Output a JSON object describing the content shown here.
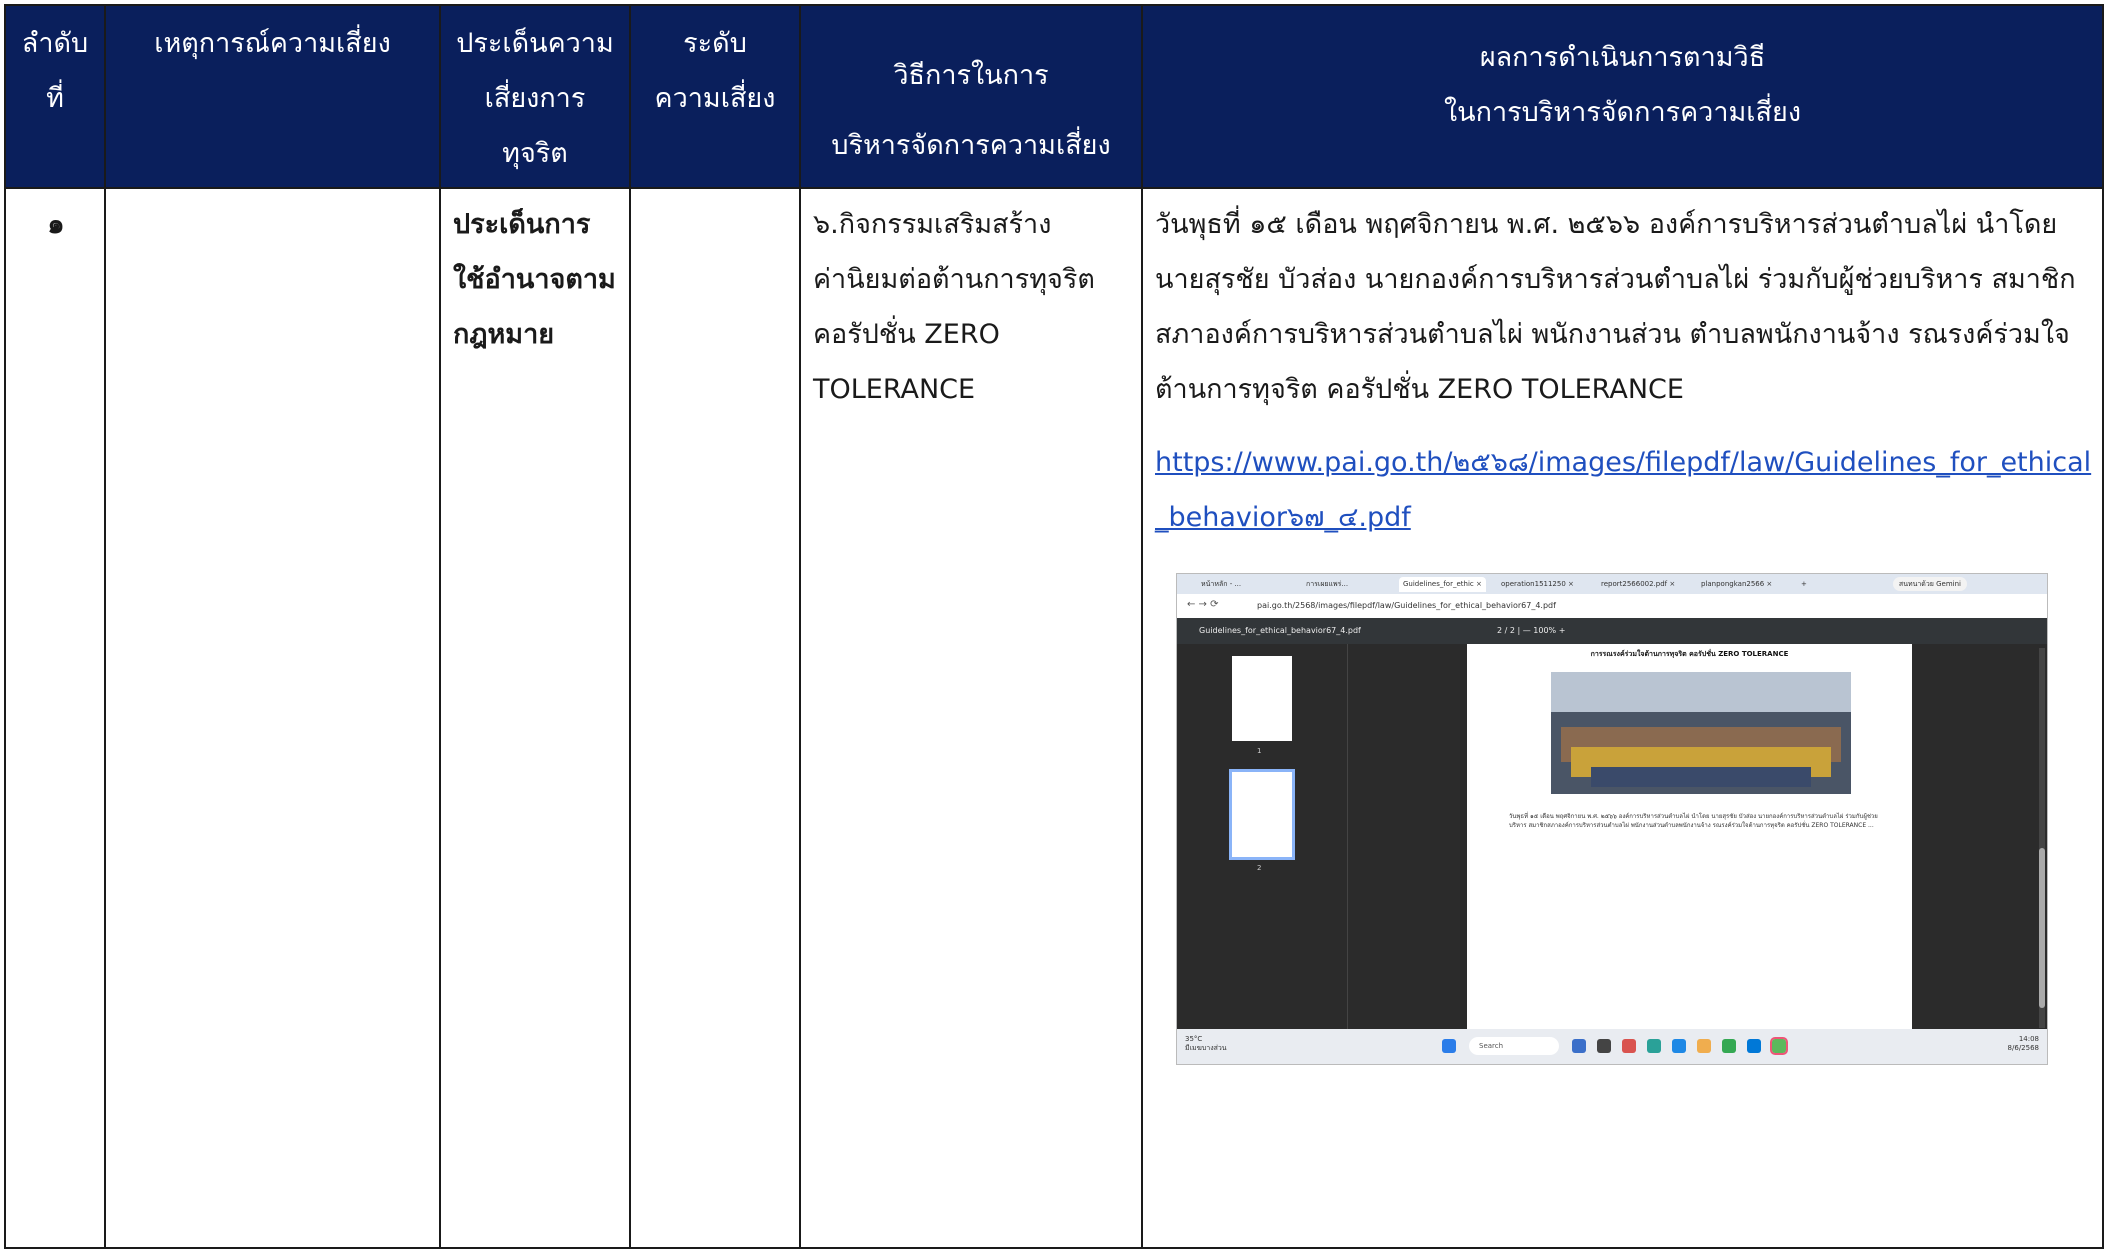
{
  "header": {
    "col_no": "ลำดับ\nที่",
    "col_event": "เหตุการณ์ความเสี่ยง",
    "col_issue": "ประเด็นความ\nเสี่ยงการ\nทุจริต",
    "col_level": "ระดับ\nความเสี่ยง",
    "col_method": "วิธีการในการ\nบริหารจัดการความเสี่ยง",
    "col_result": "ผลการดำเนินการตามวิธี\nในการบริหารจัดการความเสี่ยง"
  },
  "row": {
    "no": "๑",
    "event": "",
    "issue": "ประเด็นการ\nใช้อำนาจตาม\nกฎหมาย",
    "level": "",
    "method": "๖.กิจกรรมเสริมสร้าง\nค่านิยมต่อต้านการทุจริต\nคอรัปชั่น ZERO\nTOLERANCE",
    "result_text": "วันพุธที่ ๑๕ เดือน พฤศจิกายน พ.ศ. ๒๕๖๖ องค์การบริหารส่วนตำบลไผ่ นำโดย นายสุรชัย    บัวส่อง นายกองค์การบริหารส่วนตำบลไผ่ ร่วมกับผู้ช่วยบริหาร สมาชิกสภาองค์การบริหารส่วนตำบลไผ่ พนักงานส่วน ตำบลพนักงานจ้าง รณรงค์ร่วมใจต้านการทุจริต คอรัปชั่น ZERO TOLERANCE",
    "result_link": "https://www.pai.go.th/๒๕๖๘/images/filepdf/law/Guidelines_for_ethical_behavior๖๗_๔.pdf"
  },
  "screenshot": {
    "tabs": [
      "หน้าหลัก - ...",
      "การเผยแพร่...",
      "Guidelines_for_ethic ×",
      "operation1511250 ×",
      "report2566002.pdf ×",
      "planpongkan2566 ×",
      "+"
    ],
    "gemini_label": "สนทนาด้วย Gemini",
    "url": "pai.go.th/2568/images/filepdf/law/Guidelines_for_ethical_behavior67_4.pdf",
    "pdf_name": "Guidelines_for_ethical_behavior67_4.pdf",
    "page_indicator": "2 / 2  |  —  100%  +",
    "thumb_labels": [
      "1",
      "2"
    ],
    "page_title": "การรณรงค์ร่วมใจต้านการทุจริต คอรัปชั่น ZERO TOLERANCE",
    "page_text": "วันพุธที่ ๑๕ เดือน พฤศจิกายน พ.ศ. ๒๕๖๖ องค์การบริหารส่วนตำบลไผ่ นำโดย นายสุรชัย บัวส่อง นายกองค์การบริหารส่วนตำบลไผ่ ร่วมกับผู้ช่วยบริหาร สมาชิกสภาองค์การบริหารส่วนตำบลไผ่ พนักงานส่วนตำบลพนักงานจ้าง รณรงค์ร่วมใจต้านการทุจริต คอรัปชั่น ZERO TOLERANCE ...",
    "weather": "35°C\nมีเมฆบางส่วน",
    "search": "Search",
    "clock": "14:08\n8/6/2568"
  }
}
